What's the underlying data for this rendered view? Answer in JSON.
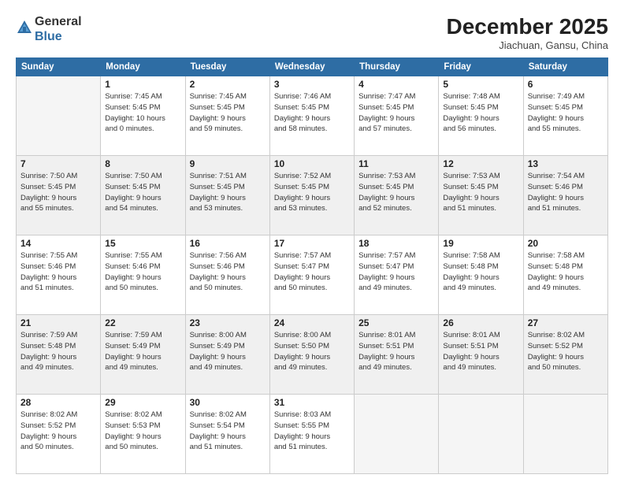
{
  "header": {
    "logo_line1": "General",
    "logo_line2": "Blue",
    "month": "December 2025",
    "location": "Jiachuan, Gansu, China"
  },
  "days_of_week": [
    "Sunday",
    "Monday",
    "Tuesday",
    "Wednesday",
    "Thursday",
    "Friday",
    "Saturday"
  ],
  "weeks": [
    [
      {
        "day": "",
        "info": ""
      },
      {
        "day": "1",
        "info": "Sunrise: 7:45 AM\nSunset: 5:45 PM\nDaylight: 10 hours\nand 0 minutes."
      },
      {
        "day": "2",
        "info": "Sunrise: 7:45 AM\nSunset: 5:45 PM\nDaylight: 9 hours\nand 59 minutes."
      },
      {
        "day": "3",
        "info": "Sunrise: 7:46 AM\nSunset: 5:45 PM\nDaylight: 9 hours\nand 58 minutes."
      },
      {
        "day": "4",
        "info": "Sunrise: 7:47 AM\nSunset: 5:45 PM\nDaylight: 9 hours\nand 57 minutes."
      },
      {
        "day": "5",
        "info": "Sunrise: 7:48 AM\nSunset: 5:45 PM\nDaylight: 9 hours\nand 56 minutes."
      },
      {
        "day": "6",
        "info": "Sunrise: 7:49 AM\nSunset: 5:45 PM\nDaylight: 9 hours\nand 55 minutes."
      }
    ],
    [
      {
        "day": "7",
        "info": "Sunrise: 7:50 AM\nSunset: 5:45 PM\nDaylight: 9 hours\nand 55 minutes."
      },
      {
        "day": "8",
        "info": "Sunrise: 7:50 AM\nSunset: 5:45 PM\nDaylight: 9 hours\nand 54 minutes."
      },
      {
        "day": "9",
        "info": "Sunrise: 7:51 AM\nSunset: 5:45 PM\nDaylight: 9 hours\nand 53 minutes."
      },
      {
        "day": "10",
        "info": "Sunrise: 7:52 AM\nSunset: 5:45 PM\nDaylight: 9 hours\nand 53 minutes."
      },
      {
        "day": "11",
        "info": "Sunrise: 7:53 AM\nSunset: 5:45 PM\nDaylight: 9 hours\nand 52 minutes."
      },
      {
        "day": "12",
        "info": "Sunrise: 7:53 AM\nSunset: 5:45 PM\nDaylight: 9 hours\nand 51 minutes."
      },
      {
        "day": "13",
        "info": "Sunrise: 7:54 AM\nSunset: 5:46 PM\nDaylight: 9 hours\nand 51 minutes."
      }
    ],
    [
      {
        "day": "14",
        "info": "Sunrise: 7:55 AM\nSunset: 5:46 PM\nDaylight: 9 hours\nand 51 minutes."
      },
      {
        "day": "15",
        "info": "Sunrise: 7:55 AM\nSunset: 5:46 PM\nDaylight: 9 hours\nand 50 minutes."
      },
      {
        "day": "16",
        "info": "Sunrise: 7:56 AM\nSunset: 5:46 PM\nDaylight: 9 hours\nand 50 minutes."
      },
      {
        "day": "17",
        "info": "Sunrise: 7:57 AM\nSunset: 5:47 PM\nDaylight: 9 hours\nand 50 minutes."
      },
      {
        "day": "18",
        "info": "Sunrise: 7:57 AM\nSunset: 5:47 PM\nDaylight: 9 hours\nand 49 minutes."
      },
      {
        "day": "19",
        "info": "Sunrise: 7:58 AM\nSunset: 5:48 PM\nDaylight: 9 hours\nand 49 minutes."
      },
      {
        "day": "20",
        "info": "Sunrise: 7:58 AM\nSunset: 5:48 PM\nDaylight: 9 hours\nand 49 minutes."
      }
    ],
    [
      {
        "day": "21",
        "info": "Sunrise: 7:59 AM\nSunset: 5:48 PM\nDaylight: 9 hours\nand 49 minutes."
      },
      {
        "day": "22",
        "info": "Sunrise: 7:59 AM\nSunset: 5:49 PM\nDaylight: 9 hours\nand 49 minutes."
      },
      {
        "day": "23",
        "info": "Sunrise: 8:00 AM\nSunset: 5:49 PM\nDaylight: 9 hours\nand 49 minutes."
      },
      {
        "day": "24",
        "info": "Sunrise: 8:00 AM\nSunset: 5:50 PM\nDaylight: 9 hours\nand 49 minutes."
      },
      {
        "day": "25",
        "info": "Sunrise: 8:01 AM\nSunset: 5:51 PM\nDaylight: 9 hours\nand 49 minutes."
      },
      {
        "day": "26",
        "info": "Sunrise: 8:01 AM\nSunset: 5:51 PM\nDaylight: 9 hours\nand 49 minutes."
      },
      {
        "day": "27",
        "info": "Sunrise: 8:02 AM\nSunset: 5:52 PM\nDaylight: 9 hours\nand 50 minutes."
      }
    ],
    [
      {
        "day": "28",
        "info": "Sunrise: 8:02 AM\nSunset: 5:52 PM\nDaylight: 9 hours\nand 50 minutes."
      },
      {
        "day": "29",
        "info": "Sunrise: 8:02 AM\nSunset: 5:53 PM\nDaylight: 9 hours\nand 50 minutes."
      },
      {
        "day": "30",
        "info": "Sunrise: 8:02 AM\nSunset: 5:54 PM\nDaylight: 9 hours\nand 51 minutes."
      },
      {
        "day": "31",
        "info": "Sunrise: 8:03 AM\nSunset: 5:55 PM\nDaylight: 9 hours\nand 51 minutes."
      },
      {
        "day": "",
        "info": ""
      },
      {
        "day": "",
        "info": ""
      },
      {
        "day": "",
        "info": ""
      }
    ]
  ]
}
